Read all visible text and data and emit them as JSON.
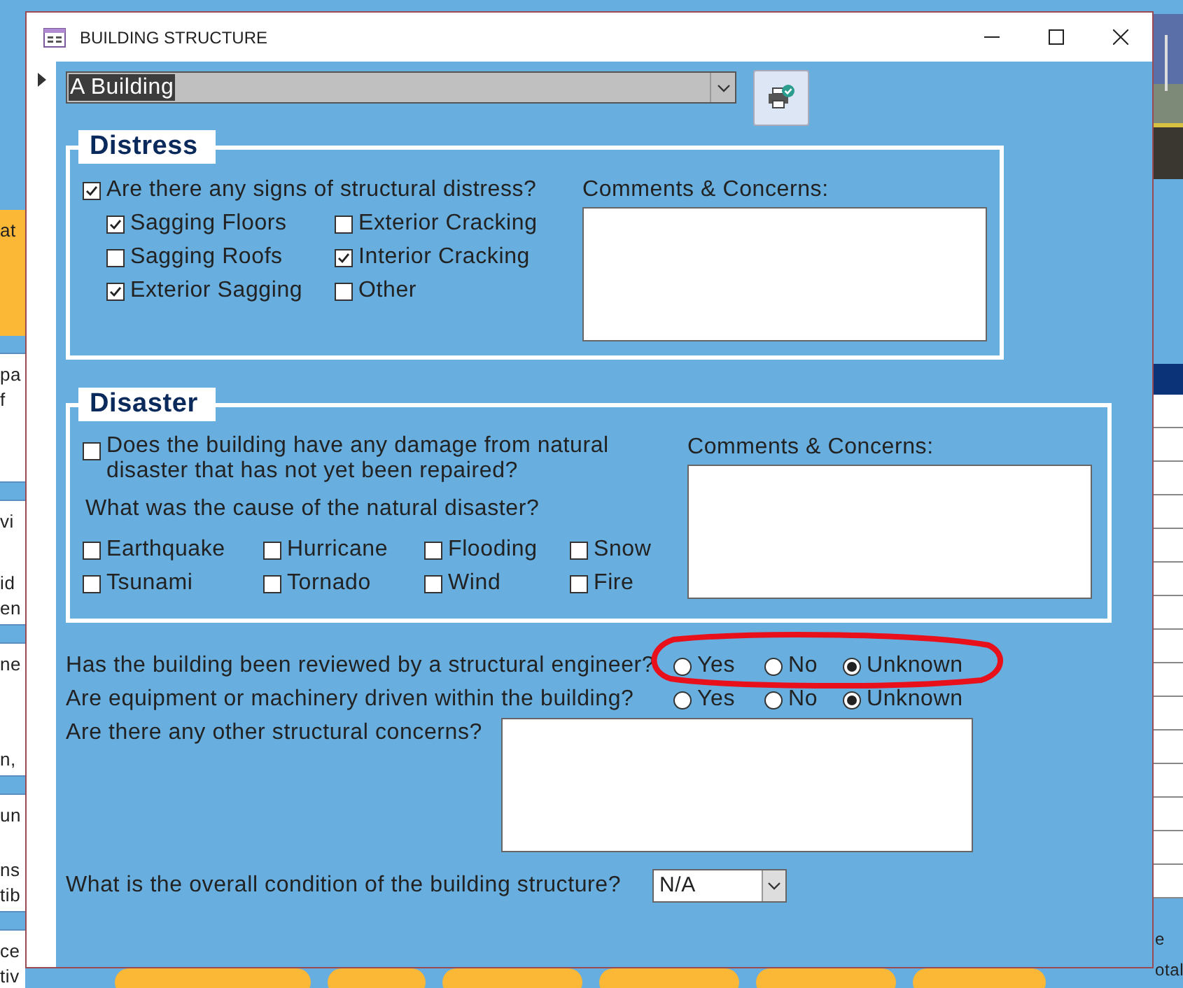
{
  "background": {
    "left_fragments": [
      {
        "groups": [
          [
            "at"
          ]
        ],
        "kind": "orange"
      },
      {
        "groups": [
          [
            "pa",
            "f"
          ]
        ],
        "kind": "white"
      },
      {
        "groups": [
          [
            "vi"
          ],
          [
            "id",
            "en"
          ]
        ],
        "kind": "white"
      },
      {
        "groups": [
          [
            "ne"
          ],
          [
            "n,"
          ]
        ],
        "kind": "white"
      },
      {
        "groups": [
          [
            "un"
          ],
          [
            "ns",
            "tib"
          ]
        ],
        "kind": "white"
      },
      {
        "groups": [
          [
            "ce",
            "tiv"
          ]
        ],
        "kind": "white"
      }
    ],
    "right_fragments": [
      "e",
      "otal"
    ]
  },
  "window": {
    "title": "BUILDING STRUCTURE"
  },
  "building_select": {
    "value": "A Building"
  },
  "distress": {
    "legend": "Distress",
    "main": {
      "label": "Are there any signs of structural distress?",
      "checked": true
    },
    "options": [
      {
        "label": "Sagging Floors",
        "checked": true
      },
      {
        "label": "Sagging Roofs",
        "checked": false
      },
      {
        "label": "Exterior Sagging",
        "checked": true
      },
      {
        "label": "Exterior Cracking",
        "checked": false
      },
      {
        "label": "Interior Cracking",
        "checked": true
      },
      {
        "label": "Other",
        "checked": false
      }
    ],
    "comments_label": "Comments & Concerns:"
  },
  "disaster": {
    "legend": "Disaster",
    "main": {
      "label": "Does the building have any damage from natural disaster that has not yet been repaired?",
      "checked": false
    },
    "cause_question": "What was the cause of the natural disaster?",
    "causes": [
      {
        "label": "Earthquake",
        "checked": false
      },
      {
        "label": "Tsunami",
        "checked": false
      },
      {
        "label": "Hurricane",
        "checked": false
      },
      {
        "label": "Tornado",
        "checked": false
      },
      {
        "label": "Flooding",
        "checked": false
      },
      {
        "label": "Wind",
        "checked": false
      },
      {
        "label": "Snow",
        "checked": false
      },
      {
        "label": "Fire",
        "checked": false
      }
    ],
    "comments_label": "Comments & Concerns:"
  },
  "questions": [
    {
      "label": "Has the building been reviewed by a structural engineer?",
      "options": [
        {
          "label": "Yes",
          "selected": false
        },
        {
          "label": "No",
          "selected": false
        },
        {
          "label": "Unknown",
          "selected": true
        }
      ]
    },
    {
      "label": "Are equipment or machinery driven within the building?",
      "options": [
        {
          "label": "Yes",
          "selected": false
        },
        {
          "label": "No",
          "selected": false
        },
        {
          "label": "Unknown",
          "selected": true
        }
      ]
    }
  ],
  "other_concerns": {
    "label": "Are there any other structural concerns?"
  },
  "condition": {
    "label": "What is the overall condition of the building structure?",
    "value": "N/A"
  }
}
